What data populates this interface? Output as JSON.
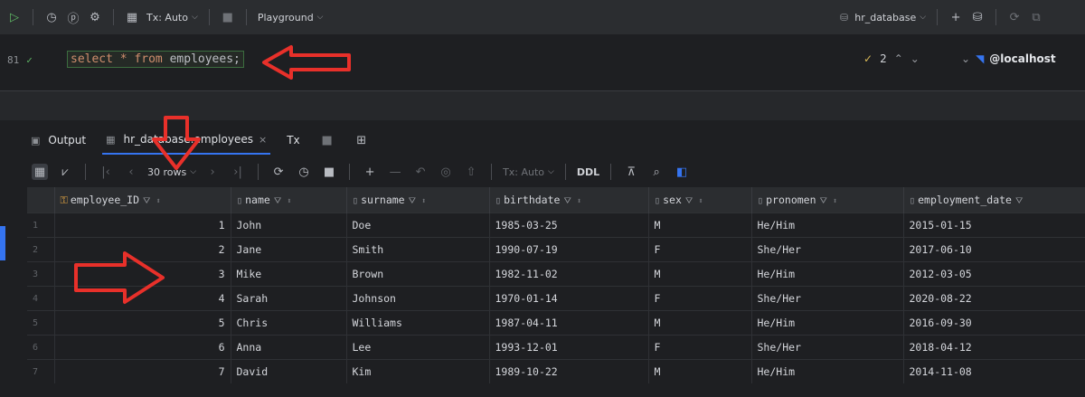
{
  "toolbar": {
    "tx_mode": "Tx: Auto",
    "playground": "Playground",
    "datasource": "hr_database"
  },
  "editor": {
    "line_number": "81",
    "query_select": "select",
    "query_star": "*",
    "query_from": "from",
    "query_table": "employees",
    "query_end": ";",
    "inspection_count": "2",
    "connection": "@localhost"
  },
  "results": {
    "tabs": {
      "output": "Output",
      "table": "hr_database.employees",
      "tx": "Tx"
    },
    "toolbar": {
      "rows": "30 rows",
      "tx_mode": "Tx: Auto",
      "ddl": "DDL"
    },
    "columns": [
      "employee_ID",
      "name",
      "surname",
      "birthdate",
      "sex",
      "pronomen",
      "employment_date"
    ],
    "rows": [
      {
        "n": "1",
        "id": "1",
        "name": "John",
        "surname": "Doe",
        "birthdate": "1985-03-25",
        "sex": "M",
        "pronomen": "He/Him",
        "employment_date": "2015-01-15"
      },
      {
        "n": "2",
        "id": "2",
        "name": "Jane",
        "surname": "Smith",
        "birthdate": "1990-07-19",
        "sex": "F",
        "pronomen": "She/Her",
        "employment_date": "2017-06-10"
      },
      {
        "n": "3",
        "id": "3",
        "name": "Mike",
        "surname": "Brown",
        "birthdate": "1982-11-02",
        "sex": "M",
        "pronomen": "He/Him",
        "employment_date": "2012-03-05"
      },
      {
        "n": "4",
        "id": "4",
        "name": "Sarah",
        "surname": "Johnson",
        "birthdate": "1970-01-14",
        "sex": "F",
        "pronomen": "She/Her",
        "employment_date": "2020-08-22"
      },
      {
        "n": "5",
        "id": "5",
        "name": "Chris",
        "surname": "Williams",
        "birthdate": "1987-04-11",
        "sex": "M",
        "pronomen": "He/Him",
        "employment_date": "2016-09-30"
      },
      {
        "n": "6",
        "id": "6",
        "name": "Anna",
        "surname": "Lee",
        "birthdate": "1993-12-01",
        "sex": "F",
        "pronomen": "She/Her",
        "employment_date": "2018-04-12"
      },
      {
        "n": "7",
        "id": "7",
        "name": "David",
        "surname": "Kim",
        "birthdate": "1989-10-22",
        "sex": "M",
        "pronomen": "He/Him",
        "employment_date": "2014-11-08"
      }
    ]
  },
  "colors": {
    "annotation": "#e8302a",
    "accent": "#3574f0",
    "keyword": "#cf8e6d"
  }
}
